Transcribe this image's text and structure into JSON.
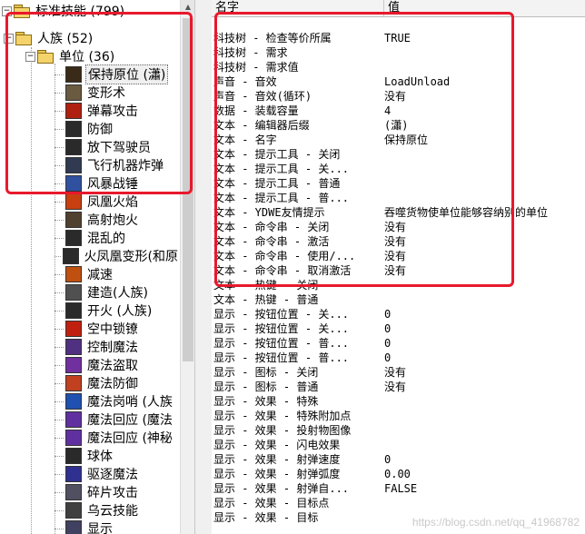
{
  "tree": {
    "root": {
      "label": "标准技能 (799)"
    },
    "race": {
      "label": "人族 (52)"
    },
    "unit_folder": {
      "label": "单位 (36)"
    },
    "items": [
      {
        "label": "保持原位 (瀟)",
        "icon": "hold-position-icon",
        "color": "#3a2a18",
        "selected": true
      },
      {
        "label": "变形术",
        "icon": "polymorph-icon",
        "color": "#6a5a40"
      },
      {
        "label": "弹幕攻击",
        "icon": "barrage-icon",
        "color": "#b02010"
      },
      {
        "label": "防御",
        "icon": "defend-icon",
        "color": "#2a2a2a"
      },
      {
        "label": "放下驾驶员",
        "icon": "unload-pilot-icon",
        "color": "#2a2a2a"
      },
      {
        "label": "飞行机器炸弹",
        "icon": "flying-bomb-icon",
        "color": "#303a50"
      },
      {
        "label": "风暴战锤",
        "icon": "storm-hammer-icon",
        "color": "#3050a0"
      },
      {
        "label": "凤凰火焰",
        "icon": "phoenix-fire-icon",
        "color": "#c84010"
      },
      {
        "label": "高射炮火",
        "icon": "flak-cannon-icon",
        "color": "#504030"
      },
      {
        "label": "混乱的",
        "icon": "chaos-icon",
        "color": "#2a2a2a"
      },
      {
        "label": "火凤凰变形(和原",
        "icon": "phoenix-morph-icon",
        "color": "#2a2a2a"
      },
      {
        "label": "减速",
        "icon": "slow-icon",
        "color": "#c05010"
      },
      {
        "label": "建造(人族)",
        "icon": "build-icon",
        "color": "#505050"
      },
      {
        "label": "开火 (人族)",
        "icon": "fire-icon",
        "color": "#2a2a2a"
      },
      {
        "label": "空中锁镣",
        "icon": "aerial-shackles-icon",
        "color": "#c02010"
      },
      {
        "label": "控制魔法",
        "icon": "control-magic-icon",
        "color": "#503080"
      },
      {
        "label": "魔法盗取",
        "icon": "spell-steal-icon",
        "color": "#7030a0"
      },
      {
        "label": "魔法防御",
        "icon": "magic-defense-icon",
        "color": "#c04020"
      },
      {
        "label": "魔法岗哨 (人族",
        "icon": "magic-sentry-icon",
        "color": "#2050b0"
      },
      {
        "label": "魔法回应 (魔法",
        "icon": "magic-feedback-icon",
        "color": "#6030a0"
      },
      {
        "label": "魔法回应 (神秘",
        "icon": "magic-feedback-2-icon",
        "color": "#6030a0"
      },
      {
        "label": "球体",
        "icon": "orb-icon",
        "color": "#2a2a2a"
      },
      {
        "label": "驱逐魔法",
        "icon": "dispel-magic-icon",
        "color": "#303090"
      },
      {
        "label": "碎片攻击",
        "icon": "fragment-attack-icon",
        "color": "#505060"
      },
      {
        "label": "乌云技能",
        "icon": "cloud-icon",
        "color": "#404040"
      },
      {
        "label": "显示",
        "icon": "reveal-icon",
        "color": "#404060"
      }
    ]
  },
  "props": {
    "headers": {
      "name": "名字",
      "value": "值"
    },
    "rows": [
      {
        "name": "科技树 - 检查等价所属",
        "value": "TRUE"
      },
      {
        "name": "科技树 - 需求",
        "value": ""
      },
      {
        "name": "科技树 - 需求值",
        "value": ""
      },
      {
        "name": "声音 - 音效",
        "value": "LoadUnload"
      },
      {
        "name": "声音 - 音效(循环)",
        "value": "没有"
      },
      {
        "name": "数据 - 装载容量",
        "value": "4"
      },
      {
        "name": "文本 - 编辑器后缀",
        "value": "(瀟)"
      },
      {
        "name": "文本 - 名字",
        "value": "保持原位"
      },
      {
        "name": "文本 - 提示工具 - 关闭",
        "value": ""
      },
      {
        "name": "文本 - 提示工具 - 关...",
        "value": ""
      },
      {
        "name": "文本 - 提示工具 - 普通",
        "value": ""
      },
      {
        "name": "文本 - 提示工具 - 普...",
        "value": ""
      },
      {
        "name": "文本 - YDWE友情提示",
        "value": "吞噬货物使单位能够容纳别的单位"
      },
      {
        "name": "文本 - 命令串 - 关闭",
        "value": "没有"
      },
      {
        "name": "文本 - 命令串 - 激活",
        "value": "没有"
      },
      {
        "name": "文本 - 命令串 - 使用/...",
        "value": "没有"
      },
      {
        "name": "文本 - 命令串 - 取消激活",
        "value": "没有"
      },
      {
        "name": "文本 - 热键 - 关闭",
        "value": ""
      },
      {
        "name": "文本 - 热键 - 普通",
        "value": ""
      },
      {
        "name": "显示 - 按钮位置 - 关...",
        "value": "0"
      },
      {
        "name": "显示 - 按钮位置 - 关...",
        "value": "0"
      },
      {
        "name": "显示 - 按钮位置 - 普...",
        "value": "0"
      },
      {
        "name": "显示 - 按钮位置 - 普...",
        "value": "0"
      },
      {
        "name": "显示 - 图标 - 关闭",
        "value": "没有"
      },
      {
        "name": "显示 - 图标 - 普通",
        "value": "没有"
      },
      {
        "name": "显示 - 效果 - 特殊",
        "value": ""
      },
      {
        "name": "显示 - 效果 - 特殊附加点",
        "value": ""
      },
      {
        "name": "显示 - 效果 - 投射物图像",
        "value": ""
      },
      {
        "name": "显示 - 效果 - 闪电效果",
        "value": ""
      },
      {
        "name": "显示 - 效果 - 射弹速度",
        "value": "0"
      },
      {
        "name": "显示 - 效果 - 射弹弧度",
        "value": "0.00"
      },
      {
        "name": "显示 - 效果 - 射弹自...",
        "value": "FALSE"
      },
      {
        "name": "显示 - 效果 - 目标点",
        "value": ""
      },
      {
        "name": "显示 - 效果 - 目标",
        "value": ""
      }
    ]
  },
  "watermark": "https://blog.csdn.net/qq_41968782",
  "colors": {
    "highlight": "#e8192c",
    "folder": "#f4d36a"
  }
}
